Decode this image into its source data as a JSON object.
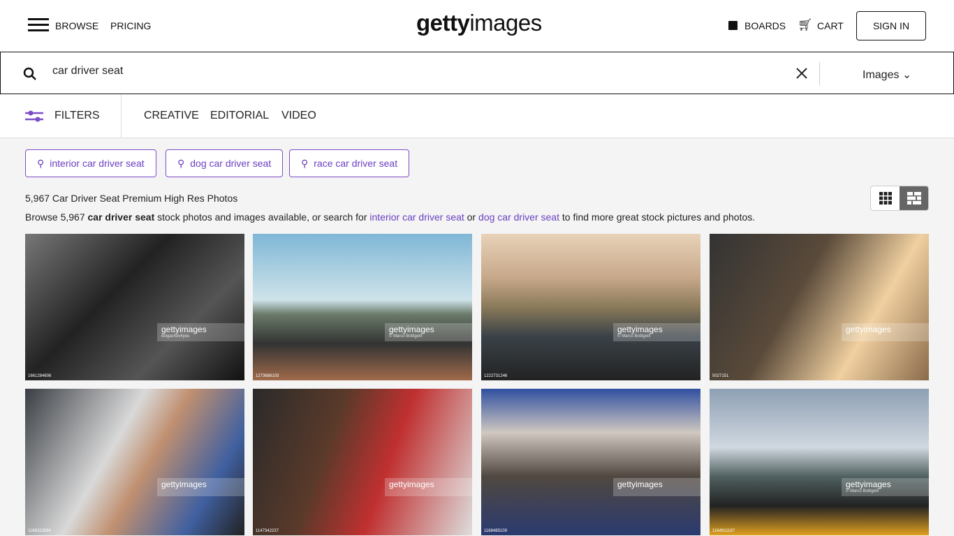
{
  "header": {
    "browse": "BROWSE",
    "pricing": "PRICING",
    "logo_bold": "getty",
    "logo_light": "images",
    "boards": "BOARDS",
    "cart": "CART",
    "sign_in": "SIGN IN"
  },
  "search": {
    "value": "car driver seat",
    "type": "Images"
  },
  "filters": {
    "label": "FILTERS",
    "tabs": [
      "CREATIVE",
      "EDITORIAL",
      "VIDEO"
    ]
  },
  "accent": "#6a3fc1",
  "suggestions": [
    "interior car driver seat",
    "dog car driver seat",
    "race car driver seat"
  ],
  "results": {
    "count_title": "5,967 Car Driver Seat Premium High Res Photos",
    "desc_prefix": "Browse 5,967 ",
    "desc_bold": "car driver seat",
    "desc_mid": " stock photos and images available, or search for ",
    "desc_link1": "interior car driver seat",
    "desc_or": " or ",
    "desc_link2": "dog car driver seat",
    "desc_suffix": " to find more great stock pictures and photos."
  },
  "images": [
    {
      "credit": "dolgachov4you",
      "id": "1661284606"
    },
    {
      "credit": "© Marco Bottigelli",
      "id": "1273688103"
    },
    {
      "credit": "© Marco Bottigelli",
      "id": "1222731246"
    },
    {
      "credit": "",
      "id": "5027151"
    },
    {
      "credit": "",
      "id": "1166322690"
    },
    {
      "credit": "",
      "id": "1147342237"
    },
    {
      "credit": "",
      "id": "1168485109"
    },
    {
      "credit": "© Marco Bottigelli",
      "id": "1164911187"
    }
  ],
  "watermark": "gettyimages"
}
